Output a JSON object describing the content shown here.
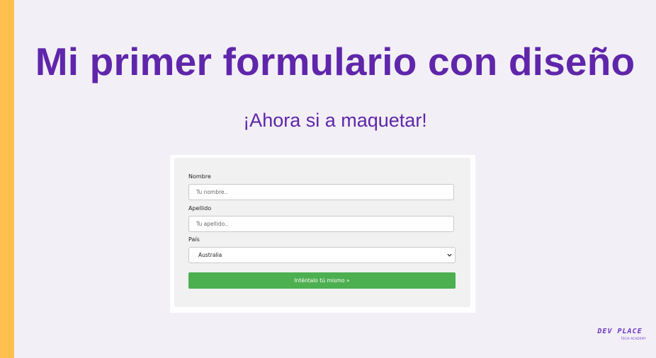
{
  "slide": {
    "title": "Mi primer formulario con diseño",
    "subtitle": "¡Ahora si a maquetar!"
  },
  "colors": {
    "accent_bar": "#ffc04d",
    "title": "#5f26ab",
    "button": "#4caf50",
    "background": "#f2eff7"
  },
  "form": {
    "nombre": {
      "label": "Nombre",
      "placeholder": "Tu nombre..",
      "value": ""
    },
    "apellido": {
      "label": "Apellido",
      "placeholder": "Tu apellido..",
      "value": ""
    },
    "pais": {
      "label": "País",
      "selected": "Australia",
      "icon": "chevron-down-icon"
    },
    "submit_label": "Inténtalo tú mismo »"
  },
  "brand": {
    "name": "DEV PLACE",
    "tagline": "TECH ACADEMY"
  }
}
